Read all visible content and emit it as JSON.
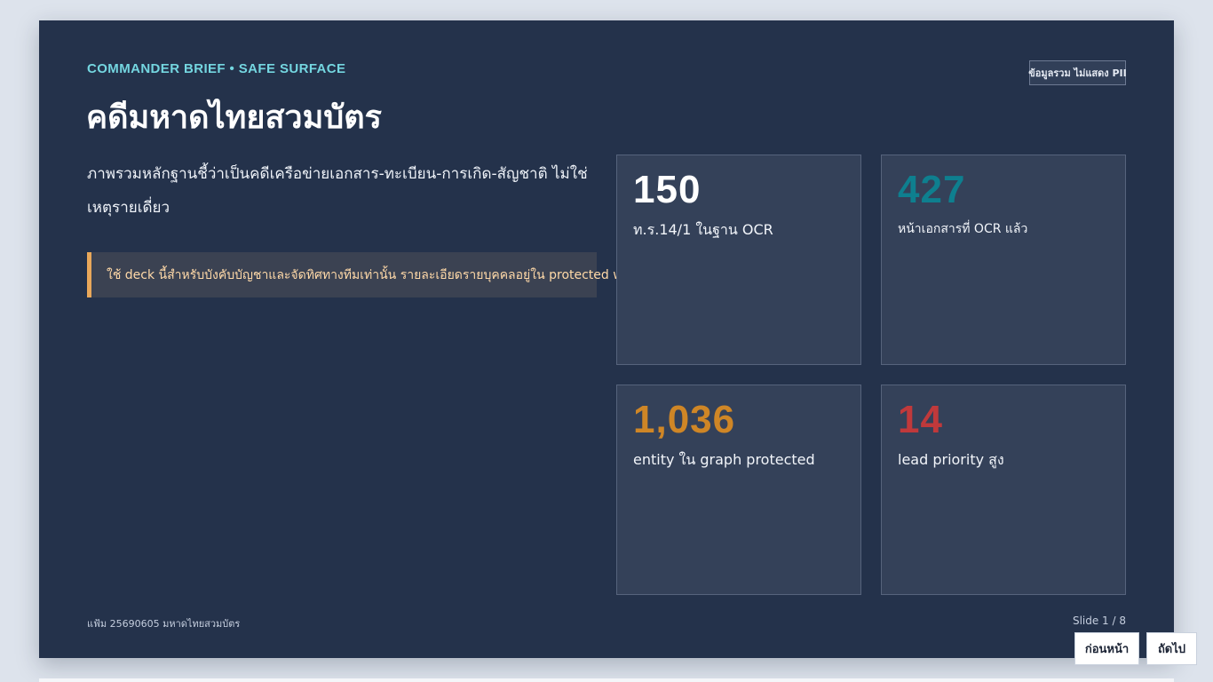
{
  "slide": {
    "eyebrow": "COMMANDER BRIEF • SAFE SURFACE",
    "pii_badge": "ข้อมูลรวม ไม่แสดง PII",
    "title": "คดีมหาดไทยสวมบัตร",
    "summary": "ภาพรวมหลักฐานชี้ว่าเป็นคดีเครือข่ายเอกสาร-ทะเบียน-การเกิด-สัญชาติ ไม่ใช่เหตุรายเดี่ยว",
    "callout": "ใช้ deck นี้สำหรับบังคับบัญชาและจัดทิศทางทีมเท่านั้น รายละเอียดรายบุคคลอยู่ใน protected workbook",
    "stats": [
      {
        "value": "150",
        "label": "ท.ร.14/1 ในฐาน OCR",
        "color": "#ffffff"
      },
      {
        "value": "427",
        "label": "หน้าเอกสารที่ OCR แล้ว",
        "color": "#0e7f8f"
      },
      {
        "value": "1,036",
        "label": "entity ใน graph protected",
        "color": "#cf8626"
      },
      {
        "value": "14",
        "label": "lead priority สูง",
        "color": "#c0393b"
      }
    ],
    "footer": "แฟ้ม 25690605 มหาดไทยสวมบัตร",
    "counter": "Slide 1 / 8"
  },
  "nav": {
    "prev_label": "ก่อนหน้า",
    "next_label": "ถัดไป"
  }
}
